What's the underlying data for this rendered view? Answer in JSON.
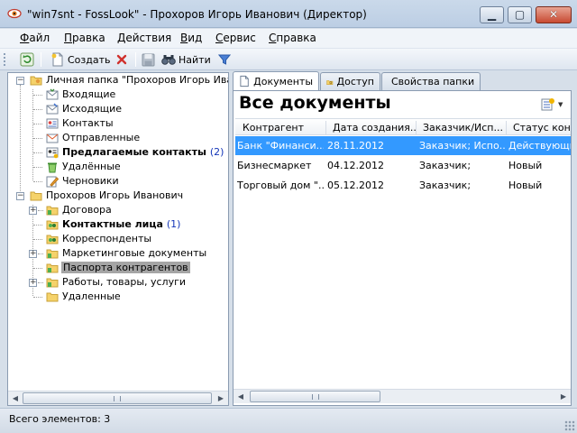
{
  "window": {
    "title": "\"win7snt - FossLook\" - Прохоров Игорь Иванович (Директор)"
  },
  "menu": {
    "items": [
      {
        "first": "Ф",
        "rest": "айл"
      },
      {
        "first": "П",
        "rest": "равка"
      },
      {
        "first": "Д",
        "rest": "ействия"
      },
      {
        "first": "В",
        "rest": "ид"
      },
      {
        "first": "С",
        "rest": "ервис"
      },
      {
        "first": "С",
        "rest": "правка"
      }
    ]
  },
  "toolbar": {
    "create_label": "Создать",
    "find_label": "Найти"
  },
  "tree": {
    "personal_folder": "Личная папка \"Прохоров Игорь Ивано",
    "inbox": "Входящие",
    "outbox": "Исходящие",
    "contacts": "Контакты",
    "sent": "Отправленные",
    "proposed_contacts": "Предлагаемые контакты",
    "proposed_count": "(2)",
    "deleted": "Удалённые",
    "drafts": "Черновики",
    "user_folder": "Прохоров Игорь Иванович",
    "contracts": "Договора",
    "contact_persons": "Контактные лица",
    "contact_persons_count": "(1)",
    "correspondents": "Корреспонденты",
    "marketing_docs": "Маркетинговые документы",
    "counterparty_passports": "Паспорта контрагентов",
    "works_goods_services": "Работы, товары, услуги",
    "removed": "Удаленные"
  },
  "tabs": {
    "documents": "Документы",
    "access": "Доступ",
    "folder_properties": "Свойства папки"
  },
  "documents": {
    "title": "Все документы",
    "columns": [
      "Контрагент",
      "Дата создания...",
      "Заказчик/Исп...",
      "Статус конт"
    ],
    "rows": [
      [
        "Банк \"Финанси...",
        "28.11.2012",
        "Заказчик; Испо...",
        "Действующи"
      ],
      [
        "Бизнесмаркет",
        "04.12.2012",
        "Заказчик;",
        "Новый"
      ],
      [
        "Торговый дом \"...",
        "05.12.2012",
        "Заказчик;",
        "Новый"
      ]
    ]
  },
  "status": {
    "text": "Всего элементов: 3"
  }
}
